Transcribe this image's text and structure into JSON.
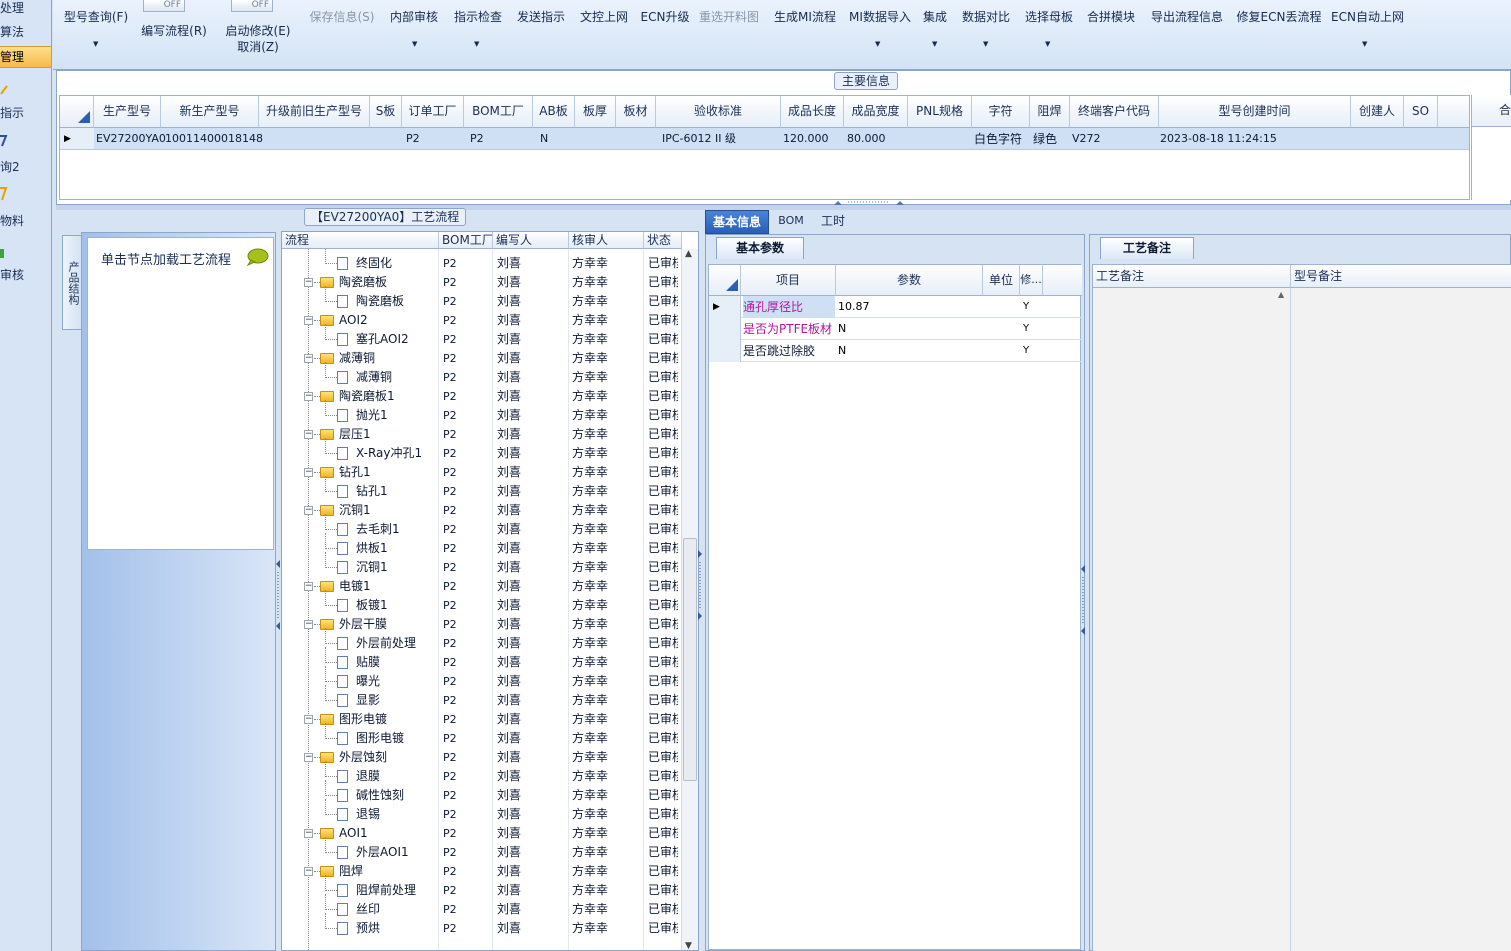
{
  "nav": {
    "items": [
      {
        "label": "处理",
        "selected": false
      },
      {
        "label": "算法",
        "selected": false
      },
      {
        "label": "管理",
        "selected": true
      },
      {
        "label": "指示",
        "selected": false
      },
      {
        "label": "询2",
        "selected": false
      },
      {
        "label": "物料",
        "selected": false
      },
      {
        "label": "审核",
        "selected": false
      }
    ]
  },
  "toolbar": {
    "model_query": "型号查询(F)",
    "write_flow": "编写流程(R)",
    "toggle1": "OFF",
    "enable_modify": "启动修改(E)",
    "cancel": "取消(Z)",
    "toggle2": "OFF",
    "save_info": "保存信息(S)",
    "internal_review": "内部审核",
    "instruction_check": "指示检查",
    "send_instruction": "发送指示",
    "document_control": "文控上网",
    "ecn_upgrade": "ECN升级",
    "reselect_material": "重选开料图",
    "generate_mi": "生成MI流程",
    "mi_import": "MI数据导入",
    "integration": "集成",
    "data_compare": "数据对比",
    "select_master": "选择母板",
    "merge_module": "合拼模块",
    "export_flow": "导出流程信息",
    "fix_ecn": "修复ECN丢流程",
    "ecn_auto_online": "ECN自动上网"
  },
  "main_info": {
    "legend": "主要信息",
    "columns": [
      "生产型号",
      "新生产型号",
      "升级前旧生产型号",
      "S板",
      "订单工厂",
      "BOM工厂",
      "AB板",
      "板厚",
      "板材",
      "验收标准",
      "成品长度",
      "成品宽度",
      "PNL规格",
      "字符",
      "阻焊",
      "终端客户代码",
      "型号创建时间",
      "创建人",
      "SO"
    ],
    "right_stub_header": "合",
    "row": {
      "production_model": "EV27200YA0",
      "new_production_model": "10011400018148",
      "old_production_model": "",
      "s_board": "",
      "order_factory": "P2",
      "bom_factory": "P2",
      "ab_board": "N",
      "thickness": "",
      "material": "",
      "acceptance_standard": "IPC-6012 II 级",
      "length": "120.000",
      "width": "80.000",
      "pnl_spec": "",
      "character": "白色字符",
      "solder_mask": "绿色",
      "customer_code": "V272",
      "create_time": "2023-08-18 11:24:15",
      "creator": "",
      "so": ""
    }
  },
  "flow": {
    "title": "【EV27200YA0】工艺流程",
    "vertical_tab": "产品结构",
    "node_hint": "单击节点加载工艺流程",
    "columns": [
      "流程",
      "BOM工厂",
      "编写人",
      "核审人",
      "状态"
    ],
    "rows": [
      {
        "name": "终固化",
        "level": 1,
        "factory": "P2",
        "writer": "刘喜",
        "reviewer": "方幸幸",
        "status": "已审核"
      },
      {
        "name": "陶瓷磨板",
        "level": 0,
        "factory": "P2",
        "writer": "刘喜",
        "reviewer": "方幸幸",
        "status": "已审核"
      },
      {
        "name": "陶瓷磨板",
        "level": 1,
        "factory": "P2",
        "writer": "刘喜",
        "reviewer": "方幸幸",
        "status": "已审核"
      },
      {
        "name": "AOI2",
        "level": 0,
        "factory": "P2",
        "writer": "刘喜",
        "reviewer": "方幸幸",
        "status": "已审核"
      },
      {
        "name": "塞孔AOI2",
        "level": 1,
        "factory": "P2",
        "writer": "刘喜",
        "reviewer": "方幸幸",
        "status": "已审核"
      },
      {
        "name": "减薄铜",
        "level": 0,
        "factory": "P2",
        "writer": "刘喜",
        "reviewer": "方幸幸",
        "status": "已审核"
      },
      {
        "name": "减薄铜",
        "level": 1,
        "factory": "P2",
        "writer": "刘喜",
        "reviewer": "方幸幸",
        "status": "已审核"
      },
      {
        "name": "陶瓷磨板1",
        "level": 0,
        "factory": "P2",
        "writer": "刘喜",
        "reviewer": "方幸幸",
        "status": "已审核"
      },
      {
        "name": "抛光1",
        "level": 1,
        "factory": "P2",
        "writer": "刘喜",
        "reviewer": "方幸幸",
        "status": "已审核"
      },
      {
        "name": "层压1",
        "level": 0,
        "factory": "P2",
        "writer": "刘喜",
        "reviewer": "方幸幸",
        "status": "已审核"
      },
      {
        "name": "X-Ray冲孔1",
        "level": 1,
        "factory": "P2",
        "writer": "刘喜",
        "reviewer": "方幸幸",
        "status": "已审核"
      },
      {
        "name": "钻孔1",
        "level": 0,
        "factory": "P2",
        "writer": "刘喜",
        "reviewer": "方幸幸",
        "status": "已审核"
      },
      {
        "name": "钻孔1",
        "level": 1,
        "factory": "P2",
        "writer": "刘喜",
        "reviewer": "方幸幸",
        "status": "已审核"
      },
      {
        "name": "沉铜1",
        "level": 0,
        "factory": "P2",
        "writer": "刘喜",
        "reviewer": "方幸幸",
        "status": "已审核"
      },
      {
        "name": "去毛刺1",
        "level": 1,
        "factory": "P2",
        "writer": "刘喜",
        "reviewer": "方幸幸",
        "status": "已审核"
      },
      {
        "name": "烘板1",
        "level": 1,
        "factory": "P2",
        "writer": "刘喜",
        "reviewer": "方幸幸",
        "status": "已审核"
      },
      {
        "name": "沉铜1",
        "level": 1,
        "factory": "P2",
        "writer": "刘喜",
        "reviewer": "方幸幸",
        "status": "已审核"
      },
      {
        "name": "电镀1",
        "level": 0,
        "factory": "P2",
        "writer": "刘喜",
        "reviewer": "方幸幸",
        "status": "已审核"
      },
      {
        "name": "板镀1",
        "level": 1,
        "factory": "P2",
        "writer": "刘喜",
        "reviewer": "方幸幸",
        "status": "已审核"
      },
      {
        "name": "外层干膜",
        "level": 0,
        "factory": "P2",
        "writer": "刘喜",
        "reviewer": "方幸幸",
        "status": "已审核"
      },
      {
        "name": "外层前处理",
        "level": 1,
        "factory": "P2",
        "writer": "刘喜",
        "reviewer": "方幸幸",
        "status": "已审核"
      },
      {
        "name": "贴膜",
        "level": 1,
        "factory": "P2",
        "writer": "刘喜",
        "reviewer": "方幸幸",
        "status": "已审核"
      },
      {
        "name": "曝光",
        "level": 1,
        "factory": "P2",
        "writer": "刘喜",
        "reviewer": "方幸幸",
        "status": "已审核"
      },
      {
        "name": "显影",
        "level": 1,
        "factory": "P2",
        "writer": "刘喜",
        "reviewer": "方幸幸",
        "status": "已审核"
      },
      {
        "name": "图形电镀",
        "level": 0,
        "factory": "P2",
        "writer": "刘喜",
        "reviewer": "方幸幸",
        "status": "已审核"
      },
      {
        "name": "图形电镀",
        "level": 1,
        "factory": "P2",
        "writer": "刘喜",
        "reviewer": "方幸幸",
        "status": "已审核"
      },
      {
        "name": "外层蚀刻",
        "level": 0,
        "factory": "P2",
        "writer": "刘喜",
        "reviewer": "方幸幸",
        "status": "已审核"
      },
      {
        "name": "退膜",
        "level": 1,
        "factory": "P2",
        "writer": "刘喜",
        "reviewer": "方幸幸",
        "status": "已审核"
      },
      {
        "name": "碱性蚀刻",
        "level": 1,
        "factory": "P2",
        "writer": "刘喜",
        "reviewer": "方幸幸",
        "status": "已审核"
      },
      {
        "name": "退锡",
        "level": 1,
        "factory": "P2",
        "writer": "刘喜",
        "reviewer": "方幸幸",
        "status": "已审核"
      },
      {
        "name": "AOI1",
        "level": 0,
        "factory": "P2",
        "writer": "刘喜",
        "reviewer": "方幸幸",
        "status": "已审核"
      },
      {
        "name": "外层AOI1",
        "level": 1,
        "factory": "P2",
        "writer": "刘喜",
        "reviewer": "方幸幸",
        "status": "已审核"
      },
      {
        "name": "阻焊",
        "level": 0,
        "factory": "P2",
        "writer": "刘喜",
        "reviewer": "方幸幸",
        "status": "已审核"
      },
      {
        "name": "阻焊前处理",
        "level": 1,
        "factory": "P2",
        "writer": "刘喜",
        "reviewer": "方幸幸",
        "status": "已审核"
      },
      {
        "name": "丝印",
        "level": 1,
        "factory": "P2",
        "writer": "刘喜",
        "reviewer": "方幸幸",
        "status": "已审核"
      },
      {
        "name": "预烘",
        "level": 1,
        "factory": "P2",
        "writer": "刘喜",
        "reviewer": "方幸幸",
        "status": "已审核"
      }
    ]
  },
  "detail": {
    "tabs": [
      {
        "label": "基本信息",
        "active": true
      },
      {
        "label": "BOM",
        "active": false
      },
      {
        "label": "工时",
        "active": false
      }
    ],
    "basic_params": {
      "tab": "基本参数",
      "columns": [
        "项目",
        "参数",
        "单位",
        "修..."
      ],
      "rows": [
        {
          "item": "通孔厚径比",
          "value": "10.87",
          "unit": "",
          "modify": "Y",
          "highlight": true
        },
        {
          "item": "是否为PTFE板材",
          "value": "N",
          "unit": "",
          "modify": "Y",
          "highlight": true
        },
        {
          "item": "是否跳过除胶",
          "value": "N",
          "unit": "",
          "modify": "Y",
          "highlight": false
        }
      ]
    },
    "process_remarks": {
      "tab": "工艺备注",
      "col1": "工艺备注",
      "col2": "型号备注"
    }
  },
  "colors": {
    "accent": "#2a5fb5",
    "highlight_text": "#b0179f",
    "selected_nav": "#f6b94a",
    "selected_row": "#cfe0f4"
  }
}
